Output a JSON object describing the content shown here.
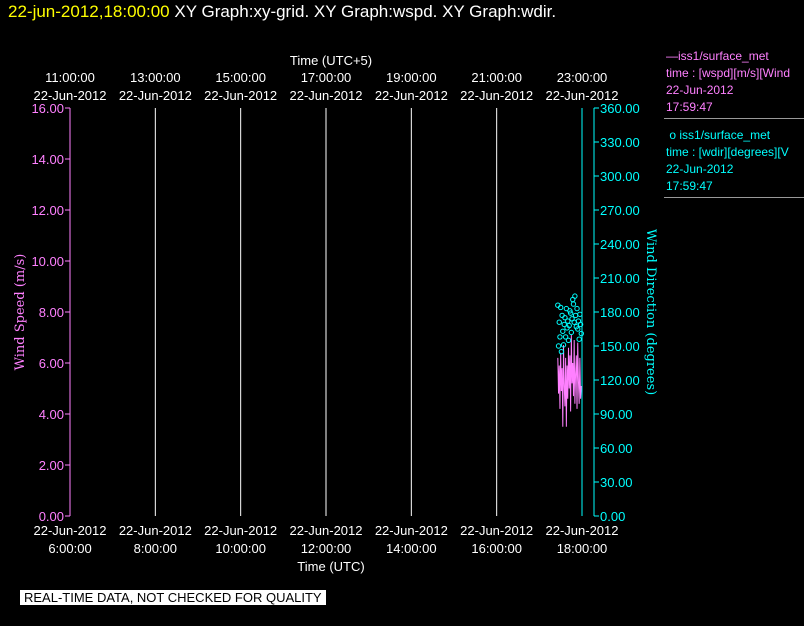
{
  "header": {
    "timestamp": "22-jun-2012,18:00:00",
    "graph_titles": "XY Graph:xy-grid.  XY Graph:wspd.  XY Graph:wdir."
  },
  "legend": {
    "wspd": {
      "marker": "—",
      "source": "iss1/surface_met",
      "desc": "time : [wspd][m/s][Wind",
      "date": "22-Jun-2012",
      "time": "17:59:47"
    },
    "wdir": {
      "marker": "o",
      "source": "iss1/surface_met",
      "desc": "time : [wdir][degrees][V",
      "date": "22-Jun-2012",
      "time": "17:59:47"
    }
  },
  "disclaimer": "REAL-TIME DATA, NOT CHECKED FOR QUALITY",
  "colors": {
    "wspd": "#ff80ff",
    "wdir": "#00ffff",
    "grid": "#ffffff",
    "background": "#000000",
    "header_timestamp": "#ffff00"
  },
  "chart_data": {
    "type": "line",
    "top_axis": {
      "title": "Time (UTC+5)",
      "ticks": [
        {
          "time": "11:00:00",
          "date": "22-Jun-2012"
        },
        {
          "time": "13:00:00",
          "date": "22-Jun-2012"
        },
        {
          "time": "15:00:00",
          "date": "22-Jun-2012"
        },
        {
          "time": "17:00:00",
          "date": "22-Jun-2012"
        },
        {
          "time": "19:00:00",
          "date": "22-Jun-2012"
        },
        {
          "time": "21:00:00",
          "date": "22-Jun-2012"
        },
        {
          "time": "23:00:00",
          "date": "22-Jun-2012"
        }
      ]
    },
    "bottom_axis": {
      "title": "Time (UTC)",
      "ticks": [
        {
          "time": "6:00:00",
          "date": "22-Jun-2012"
        },
        {
          "time": "8:00:00",
          "date": "22-Jun-2012"
        },
        {
          "time": "10:00:00",
          "date": "22-Jun-2012"
        },
        {
          "time": "12:00:00",
          "date": "22-Jun-2012"
        },
        {
          "time": "14:00:00",
          "date": "22-Jun-2012"
        },
        {
          "time": "16:00:00",
          "date": "22-Jun-2012"
        },
        {
          "time": "18:00:00",
          "date": "22-Jun-2012"
        }
      ],
      "xlim": [
        "2012-06-22 06:00",
        "2012-06-22 18:00"
      ]
    },
    "left_axis": {
      "title": "Wind Speed (m/s)",
      "ticks": [
        "0.00",
        "2.00",
        "4.00",
        "6.00",
        "8.00",
        "10.00",
        "12.00",
        "14.00",
        "16.00"
      ],
      "ylim": [
        0,
        16
      ]
    },
    "right_axis": {
      "title": "Wind Direction (degrees)",
      "ticks": [
        "0.00",
        "30.00",
        "60.00",
        "90.00",
        "120.00",
        "150.00",
        "180.00",
        "210.00",
        "240.00",
        "270.00",
        "300.00",
        "330.00",
        "360.00"
      ],
      "ylim": [
        0,
        360
      ]
    },
    "grid": true,
    "series": [
      {
        "name": "iss1/surface_met",
        "axis": "left",
        "style": "line",
        "x": [
          "17:26",
          "17:27",
          "17:28",
          "17:29",
          "17:30",
          "17:31",
          "17:32",
          "17:33",
          "17:34",
          "17:35",
          "17:36",
          "17:37",
          "17:38",
          "17:39",
          "17:40",
          "17:41",
          "17:42",
          "17:43",
          "17:44",
          "17:45",
          "17:46",
          "17:47",
          "17:48",
          "17:49",
          "17:50",
          "17:51",
          "17:52",
          "17:53",
          "17:54",
          "17:55",
          "17:56",
          "17:57",
          "17:58",
          "17:59"
        ],
        "values": [
          6.2,
          4.8,
          5.9,
          4.2,
          6.4,
          4.9,
          5.8,
          3.5,
          6.7,
          5.1,
          4.3,
          6.2,
          3.5,
          5.9,
          4.6,
          6.6,
          5.0,
          6.3,
          4.1,
          7.1,
          5.2,
          6.0,
          4.7,
          6.9,
          4.4,
          5.6,
          6.3,
          4.2,
          6.8,
          5.3,
          4.4,
          6.2,
          4.6,
          5.1
        ]
      },
      {
        "name": "iss1/surface_met",
        "axis": "right",
        "style": "markers",
        "x": [
          "17:26",
          "17:27",
          "17:28",
          "17:29",
          "17:30",
          "17:31",
          "17:32",
          "17:33",
          "17:34",
          "17:35",
          "17:36",
          "17:37",
          "17:38",
          "17:39",
          "17:40",
          "17:41",
          "17:42",
          "17:43",
          "17:44",
          "17:45",
          "17:46",
          "17:47",
          "17:48",
          "17:49",
          "17:50",
          "17:51",
          "17:52",
          "17:53",
          "17:54",
          "17:55",
          "17:56",
          "17:57",
          "17:58",
          "17:59"
        ],
        "values": [
          186,
          150,
          171,
          158,
          184,
          145,
          177,
          163,
          151,
          169,
          175,
          158,
          183,
          166,
          172,
          155,
          168,
          181,
          179,
          162,
          174,
          191,
          187,
          171,
          194,
          177,
          167,
          183,
          165,
          172,
          156,
          178,
          169,
          161
        ]
      }
    ]
  }
}
